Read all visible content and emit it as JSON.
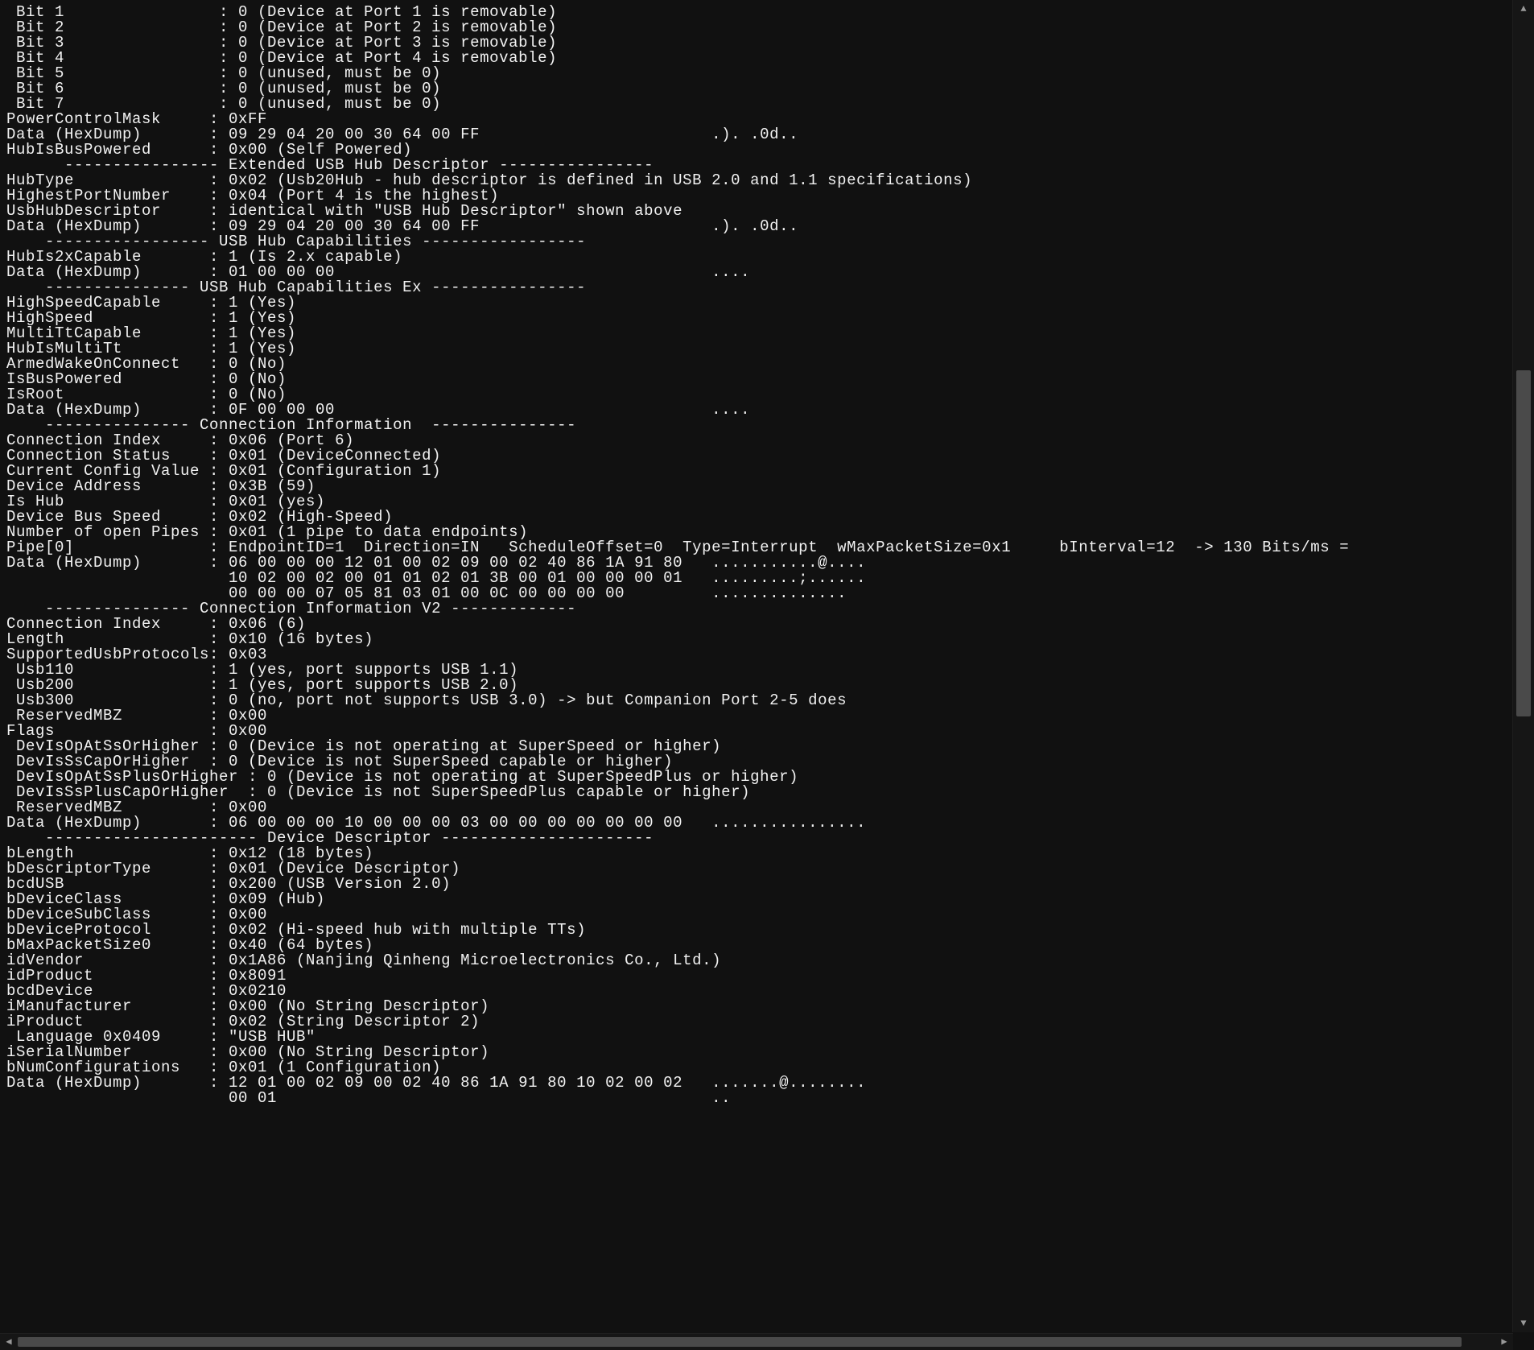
{
  "lines": [
    " Bit 1                : 0 (Device at Port 1 is removable)",
    " Bit 2                : 0 (Device at Port 2 is removable)",
    " Bit 3                : 0 (Device at Port 3 is removable)",
    " Bit 4                : 0 (Device at Port 4 is removable)",
    " Bit 5                : 0 (unused, must be 0)",
    " Bit 6                : 0 (unused, must be 0)",
    " Bit 7                : 0 (unused, must be 0)",
    "PowerControlMask     : 0xFF",
    "Data (HexDump)       : 09 29 04 20 00 30 64 00 FF                        .). .0d..",
    "HubIsBusPowered      : 0x00 (Self Powered)",
    "",
    "      ---------------- Extended USB Hub Descriptor ----------------",
    "HubType              : 0x02 (Usb20Hub - hub descriptor is defined in USB 2.0 and 1.1 specifications)",
    "HighestPortNumber    : 0x04 (Port 4 is the highest)",
    "UsbHubDescriptor     : identical with \"USB Hub Descriptor\" shown above",
    "Data (HexDump)       : 09 29 04 20 00 30 64 00 FF                        .). .0d..",
    "",
    "    ----------------- USB Hub Capabilities -----------------",
    "HubIs2xCapable       : 1 (Is 2.x capable)",
    "Data (HexDump)       : 01 00 00 00                                       ....",
    "",
    "    --------------- USB Hub Capabilities Ex ----------------",
    "HighSpeedCapable     : 1 (Yes)",
    "HighSpeed            : 1 (Yes)",
    "MultiTtCapable       : 1 (Yes)",
    "HubIsMultiTt         : 1 (Yes)",
    "ArmedWakeOnConnect   : 0 (No)",
    "IsBusPowered         : 0 (No)",
    "IsRoot               : 0 (No)",
    "Data (HexDump)       : 0F 00 00 00                                       ....",
    "",
    "    --------------- Connection Information  ---------------",
    "Connection Index     : 0x06 (Port 6)",
    "Connection Status    : 0x01 (DeviceConnected)",
    "Current Config Value : 0x01 (Configuration 1)",
    "Device Address       : 0x3B (59)",
    "Is Hub               : 0x01 (yes)",
    "Device Bus Speed     : 0x02 (High-Speed)",
    "Number of open Pipes : 0x01 (1 pipe to data endpoints)",
    "Pipe[0]              : EndpointID=1  Direction=IN   ScheduleOffset=0  Type=Interrupt  wMaxPacketSize=0x1     bInterval=12  -> 130 Bits/ms = ",
    "Data (HexDump)       : 06 00 00 00 12 01 00 02 09 00 02 40 86 1A 91 80   ...........@....",
    "                       10 02 00 02 00 01 01 02 01 3B 00 01 00 00 00 01   .........;......",
    "                       00 00 00 07 05 81 03 01 00 0C 00 00 00 00         ..............",
    "",
    "    --------------- Connection Information V2 -------------",
    "Connection Index     : 0x06 (6)",
    "Length               : 0x10 (16 bytes)",
    "SupportedUsbProtocols: 0x03",
    " Usb110              : 1 (yes, port supports USB 1.1)",
    " Usb200              : 1 (yes, port supports USB 2.0)",
    " Usb300              : 0 (no, port not supports USB 3.0) -> but Companion Port 2-5 does",
    " ReservedMBZ         : 0x00",
    "Flags                : 0x00",
    " DevIsOpAtSsOrHigher : 0 (Device is not operating at SuperSpeed or higher)",
    " DevIsSsCapOrHigher  : 0 (Device is not SuperSpeed capable or higher)",
    " DevIsOpAtSsPlusOrHigher : 0 (Device is not operating at SuperSpeedPlus or higher)",
    " DevIsSsPlusCapOrHigher  : 0 (Device is not SuperSpeedPlus capable or higher)",
    " ReservedMBZ         : 0x00",
    "Data (HexDump)       : 06 00 00 00 10 00 00 00 03 00 00 00 00 00 00 00   ................",
    "",
    "    ---------------------- Device Descriptor ----------------------",
    "bLength              : 0x12 (18 bytes)",
    "bDescriptorType      : 0x01 (Device Descriptor)",
    "bcdUSB               : 0x200 (USB Version 2.0)",
    "bDeviceClass         : 0x09 (Hub)",
    "bDeviceSubClass      : 0x00",
    "bDeviceProtocol      : 0x02 (Hi-speed hub with multiple TTs)",
    "bMaxPacketSize0      : 0x40 (64 bytes)",
    "idVendor             : 0x1A86 (Nanjing Qinheng Microelectronics Co., Ltd.)",
    "idProduct            : 0x8091",
    "bcdDevice            : 0x0210",
    "iManufacturer        : 0x00 (No String Descriptor)",
    "iProduct             : 0x02 (String Descriptor 2)",
    " Language 0x0409     : \"USB HUB\"",
    "iSerialNumber        : 0x00 (No String Descriptor)",
    "bNumConfigurations   : 0x01 (1 Configuration)",
    "Data (HexDump)       : 12 01 00 02 09 00 02 40 86 1A 91 80 10 02 00 02   .......@........",
    "                       00 01                                             .."
  ],
  "scrollbars": {
    "vertical_up": "▲",
    "vertical_down": "▼",
    "horizontal_left": "◀",
    "horizontal_right": "▶"
  }
}
